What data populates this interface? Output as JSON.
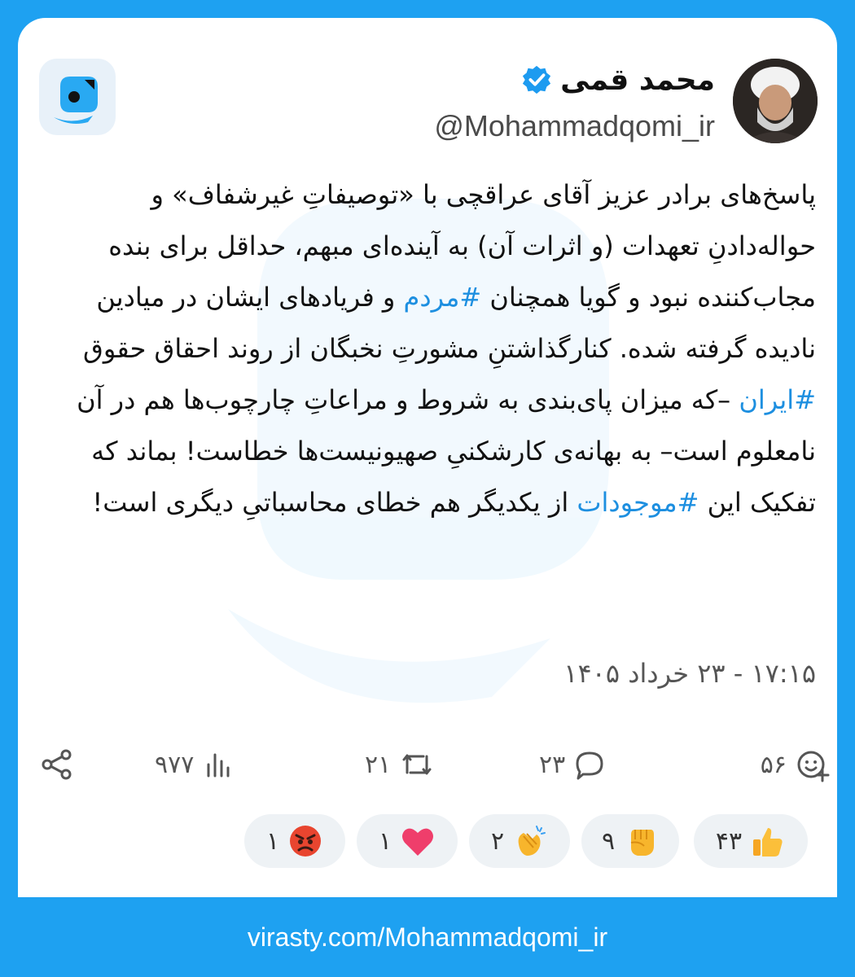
{
  "author": {
    "name": "محمد قمی",
    "handle": "@Mohammadqomi_ir"
  },
  "post": {
    "segments": [
      {
        "text": "پاسخ‌های برادر عزیز آقای عراقچی با «توصیفاتِ غیرشفاف» و حواله‌دادنِ تعهدات (و اثرات آن) به آینده‌ای مبهم، حداقل برای بنده مجاب‌کننده نبود و گویا همچنان ",
        "hashtag": false
      },
      {
        "text": "#مردم",
        "hashtag": true
      },
      {
        "text": " و فریادهای ایشان در میادین نادیده گرفته شده. کنارگذاشتنِ مشورتِ نخبگان از روند احقاق حقوق ",
        "hashtag": false
      },
      {
        "text": "#ایران",
        "hashtag": true
      },
      {
        "text": " –که میزان پای‌بندی به شروط و مراعاتِ چارچوب‌ها هم در آن نامعلوم است– به بهانه‌ی کارشکنیِ صهیونیست‌ها خطاست! بماند که تفکیک این ",
        "hashtag": false
      },
      {
        "text": "#موجودات",
        "hashtag": true
      },
      {
        "text": " از یکدیگر هم خطای محاسباتیِ دیگری است!",
        "hashtag": false
      }
    ]
  },
  "timestamp": "۱۷:۱۵ - ۲۳ خرداد ۱۴۰۵",
  "stats": {
    "reactions_count": "۵۶",
    "replies_count": "۲۳",
    "reposts_count": "۲۱",
    "views_count": "۹۷۷"
  },
  "reactions": [
    {
      "emoji": "thumbs-up",
      "count": "۴۳"
    },
    {
      "emoji": "raised-fist",
      "count": "۹"
    },
    {
      "emoji": "clapping-hands",
      "count": "۲"
    },
    {
      "emoji": "red-heart",
      "count": "۱"
    },
    {
      "emoji": "angry-face",
      "count": "۱"
    }
  ],
  "footer": {
    "url": "virasty.com/Mohammadqomi_ir"
  },
  "colors": {
    "brand_blue": "#1ea1f1",
    "hashtag": "#1d8fe0",
    "verified": "#1d9bf0"
  }
}
